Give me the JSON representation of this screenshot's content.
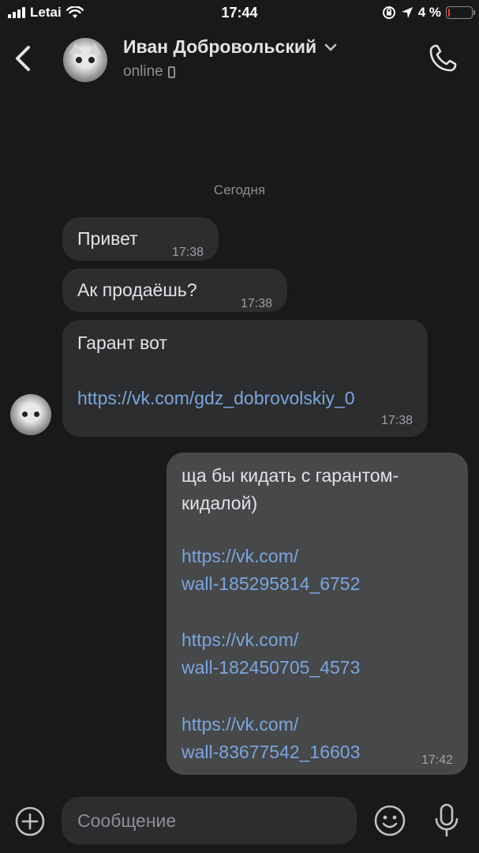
{
  "status_bar": {
    "carrier": "Letai",
    "time": "17:44",
    "battery": "4 %",
    "battery_level": 0.04
  },
  "header": {
    "contact_name": "Иван Добровольский",
    "status": "online",
    "icons": {
      "back": "chevron-left-icon",
      "dropdown": "chevron-down-icon",
      "call": "phone-icon",
      "device": "mobile-device-icon"
    }
  },
  "date_separator": "Сегодня",
  "messages": [
    {
      "direction": "in",
      "text": "Привет",
      "time": "17:38"
    },
    {
      "direction": "in",
      "text": "Ак продаёшь?",
      "time": "17:38"
    },
    {
      "direction": "in",
      "text": "Гарант вот",
      "link": "https://vk.com/gdz_dobrovolskiy_0",
      "time": "17:38"
    },
    {
      "direction": "out",
      "text_line1": "ща бы кидать с гарантом-",
      "text_line2": "кидалой)",
      "links": [
        {
          "line1": "https://vk.com/",
          "line2": "wall-185295814_6752"
        },
        {
          "line1": "https://vk.com/",
          "line2": "wall-182450705_4573"
        },
        {
          "line1": "https://vk.com/",
          "line2": "wall-83677542_16603"
        }
      ],
      "time": "17:42"
    }
  ],
  "composer": {
    "placeholder": "Сообщение",
    "icons": {
      "attach": "plus-circle-icon",
      "emoji": "emoji-icon",
      "voice": "microphone-icon"
    }
  }
}
